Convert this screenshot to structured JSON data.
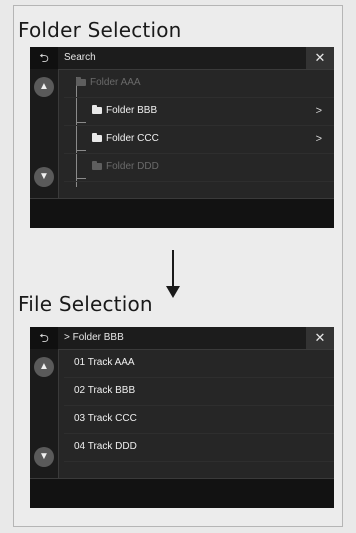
{
  "folder_panel": {
    "heading": "Folder Selection",
    "search_label": "Search",
    "back_glyph": "⮌",
    "close_glyph": "✕",
    "items": [
      {
        "label": "Folder AAA",
        "enabled": false
      },
      {
        "label": "Folder BBB",
        "enabled": true,
        "chevron": ">"
      },
      {
        "label": "Folder CCC",
        "enabled": true,
        "chevron": ">"
      },
      {
        "label": "Folder DDD",
        "enabled": false
      }
    ]
  },
  "file_panel": {
    "heading": "File Selection",
    "path_label": "> Folder BBB",
    "back_glyph": "⮌",
    "close_glyph": "✕",
    "tracks": [
      "01 Track AAA",
      "02 Track BBB",
      "03 Track CCC",
      "04 Track DDD"
    ]
  },
  "icons": {
    "scroll_up": "▲",
    "scroll_down": "▼",
    "folder": "folder-icon",
    "back": "back-icon",
    "close": "close-icon"
  },
  "colors": {
    "screen_bg": "#262626",
    "accent": "#ffffff"
  }
}
